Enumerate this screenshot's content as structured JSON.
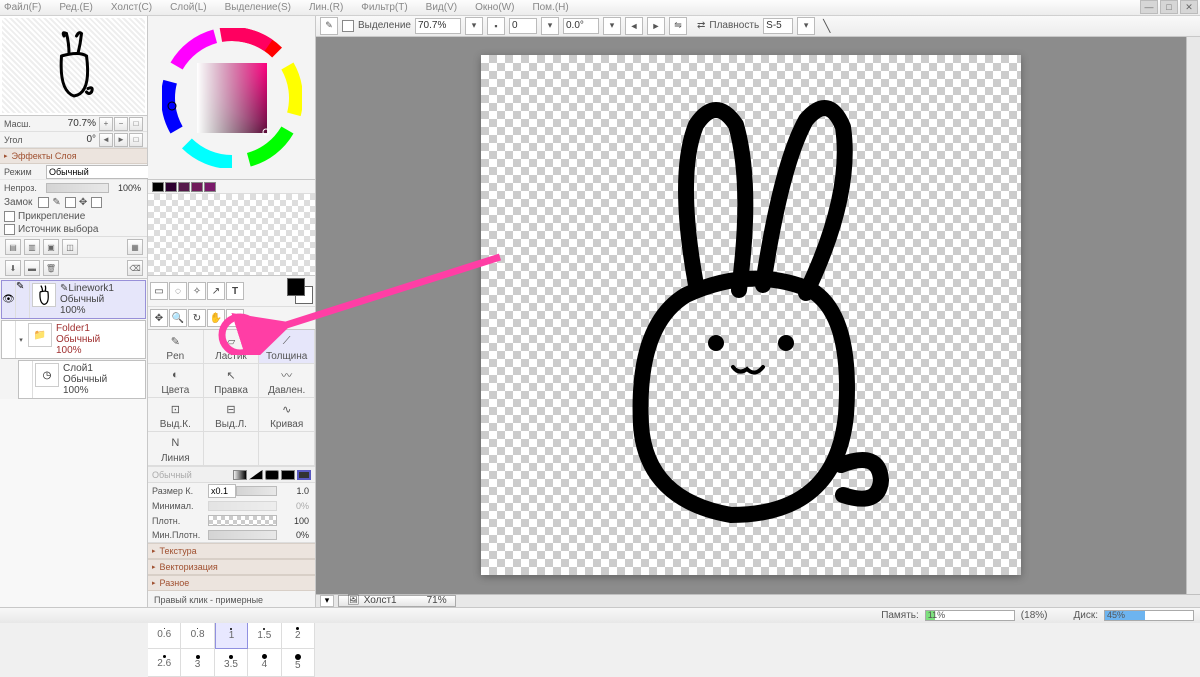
{
  "menu": {
    "items": [
      "Файл(F)",
      "Ред.(E)",
      "Холст(C)",
      "Слой(L)",
      "Выделение(S)",
      "Лин.(R)",
      "Фильтр(T)",
      "Вид(V)",
      "Окно(W)",
      "Пом.(H)"
    ]
  },
  "tool_options": {
    "selection_label": "Выделение",
    "zoom_pct": "70.7%",
    "value_a": "0",
    "value_b": "0.0°",
    "smoothness_label": "Плавность",
    "smoothness_value": "S-5"
  },
  "nav": {
    "scale_label": "Масш.",
    "scale_value": "70.7%",
    "angle_label": "Угол",
    "angle_value": "0°"
  },
  "layer_fx_hdr": "Эффекты Слоя",
  "layer_panel": {
    "mode_label": "Режим",
    "mode_value": "Обычный",
    "opacity_label": "Непроз.",
    "opacity_value": "100%",
    "lock_label": "Замок",
    "attach_label": "Прикрепление",
    "source_label": "Источник выбора"
  },
  "layers": [
    {
      "name": "Linework1",
      "mode": "Обычный",
      "opacity": "100%",
      "active": true,
      "icon": "pen"
    },
    {
      "name": "Folder1",
      "mode": "Обычный",
      "opacity": "100%",
      "folder": true
    },
    {
      "name": "Слой1",
      "mode": "Обычный",
      "opacity": "100%",
      "child": true
    }
  ],
  "tool_presets": [
    [
      "Pen",
      "Ластик",
      "Толщина",
      "Цвета"
    ],
    [
      "Правка",
      "Давлен.",
      "Выд.К.",
      "Выд.Л."
    ],
    [
      "Кривая",
      "Линия",
      "",
      ""
    ]
  ],
  "brush": {
    "mode_disabled": "Обычный",
    "size_label": "Размер К.",
    "size_unit": "x0.1",
    "size_value": "1.0",
    "min_label": "Минимал.",
    "min_value": "0%",
    "density_label": "Плотн.",
    "density_value": "100",
    "mindensity_label": "Мин.Плотн.",
    "mindensity_value": "0%"
  },
  "sections": {
    "texture": "Текстура",
    "vector": "Векторизация",
    "misc": "Разное"
  },
  "hint": "Правый клик - примерные параметры штриха.",
  "stroke_sizes": [
    "0.6",
    "0.8",
    "1",
    "1.5",
    "2",
    "2.6",
    "3",
    "3.5",
    "4",
    "5"
  ],
  "stroke_selected_index": 2,
  "canvas_tab": {
    "name": "Холст1",
    "zoom": "71%"
  },
  "status": {
    "mem_label": "Память:",
    "mem_pct": "11%",
    "mem_extra": "(18%)",
    "disk_label": "Диск:",
    "disk_pct": "45%"
  },
  "swatch_colors": [
    "#000000",
    "#2d0030",
    "#55184a",
    "#701a5a",
    "#7a1a6a"
  ],
  "shape_swatches": [
    "#000",
    "#000",
    "#000",
    "#000",
    "#333"
  ]
}
